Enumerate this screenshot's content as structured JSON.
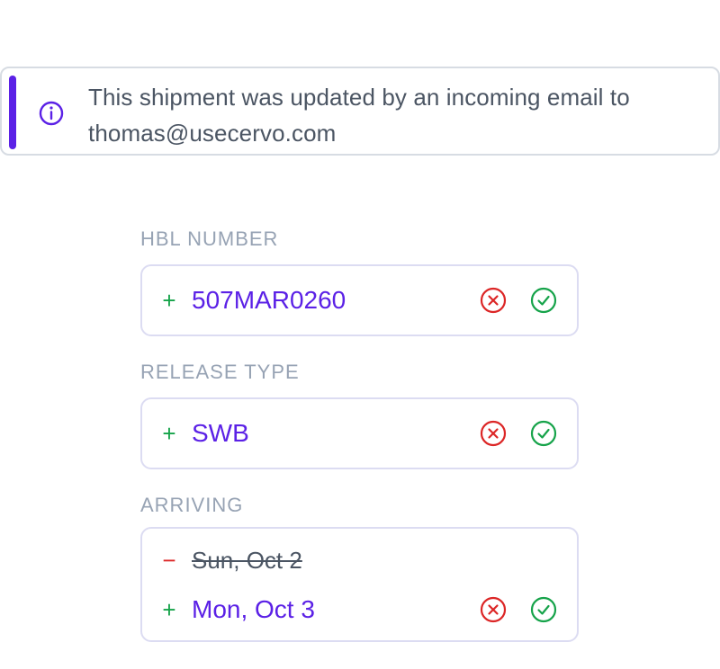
{
  "banner": {
    "icon": "info-icon",
    "message": "This shipment was updated by an incoming email to thomas@usecervo.com",
    "accent_color": "#5b21e6"
  },
  "fields": [
    {
      "label": "HBL NUMBER",
      "added": "507MAR0260"
    },
    {
      "label": "RELEASE TYPE",
      "added": "SWB"
    },
    {
      "label": "ARRIVING",
      "removed": "Sun, Oct 2",
      "added": "Mon, Oct 3"
    }
  ],
  "signs": {
    "add": "+",
    "remove": "−"
  },
  "icons": {
    "reject": "x-circle-icon",
    "accept": "check-circle-icon"
  },
  "colors": {
    "added_value": "#5b21e6",
    "add_sign": "#16a34a",
    "remove_sign": "#dc2626",
    "label": "#97a3b4"
  }
}
